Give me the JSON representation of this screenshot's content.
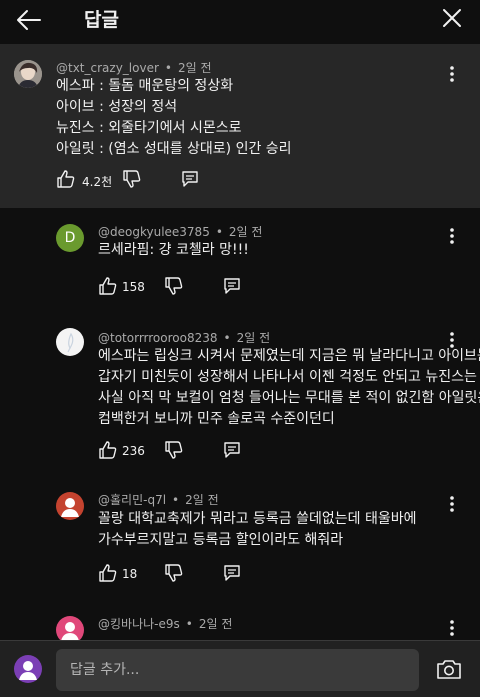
{
  "header": {
    "title": "답글"
  },
  "top_comment": {
    "author": "@txt_crazy_lover",
    "time": "2일 전",
    "lines": [
      "에스파 : 돌돔 매운탕의 정상화",
      "아이브 : 성장의 정석",
      "뉴진스 : 외줄타기에서 시몬스로",
      "아일릿 : (염소 성대를 상대로) 인간 승리"
    ],
    "likes": "4.2천"
  },
  "replies": [
    {
      "author": "@deogkyulee3785",
      "time": "2일 전",
      "avatar_letter": "D",
      "avatar_color": "#6a9a2e",
      "lines": [
        "르세라핌: 걍 코첼라 망!!!"
      ],
      "likes": "158"
    },
    {
      "author": "@totorrrrooroo8238",
      "time": "2일 전",
      "lines": [
        "에스파는 립싱크 시켜서 문제였는데 지금은 뭐 날라다니고 아이브는",
        "갑자기 미친듯이 성장해서 나타나서 이젠 걱정도 안되고 뉴진스는",
        "사실 아직 막 보컬이 엄청 들어나는 무대를 본 적이 없긴함 아일릿은",
        "컴백한거 보니까 민주 솔로곡 수준이던디"
      ],
      "likes": "236"
    },
    {
      "author": "@홀리민-q7l",
      "time": "2일 전",
      "lines": [
        "꼴랑 대학교축제가 뭐라고 등록금 쓸데없는데 태울바에",
        "가수부르지말고 등록금 할인이라도 해줘라"
      ],
      "likes": "18"
    },
    {
      "author": "@킹바나나-e9s",
      "time": "2일 전",
      "lines": []
    }
  ],
  "composer": {
    "placeholder": "답글 추가..."
  },
  "colors": {
    "background": "#0f0f0f",
    "highlight": "#272727",
    "meta": "#aaaaaa",
    "input": "#3a3a3a",
    "user_avatar": "#7b3fb5"
  }
}
